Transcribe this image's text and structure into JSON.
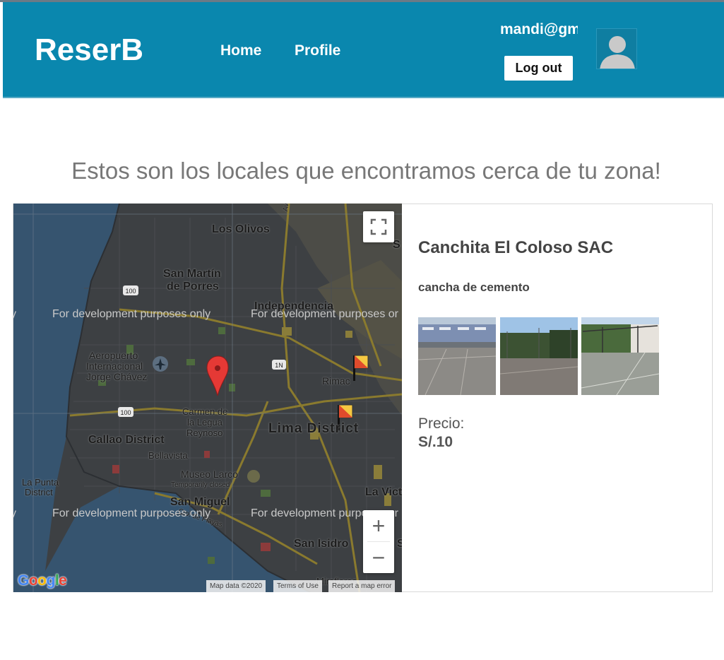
{
  "navbar": {
    "brand": "ReserB",
    "links": [
      {
        "label": "Home"
      },
      {
        "label": "Profile"
      }
    ],
    "user_email": "mandi@gm",
    "logout_label": "Log out",
    "bg_color": "#0a87ae"
  },
  "page": {
    "headline": "Estos son los locales que encontramos cerca de tu zona!"
  },
  "map": {
    "labels": {
      "los_olivos": "Los Olivos",
      "san_martin_1": "San Martín",
      "san_martin_2": "de Porres",
      "independencia": "Independencia",
      "aeropuerto_1": "Aeropuerto",
      "aeropuerto_2": "Internacional",
      "aeropuerto_3": "Jorge Chávez",
      "rimac": "Rimac",
      "carmen_1": "Carmen de",
      "carmen_2": "la Legua",
      "carmen_3": "Reynoso",
      "lima_district": "Lima District",
      "callao_district": "Callao District",
      "bellavista": "Bellavista",
      "museo_larco": "Museo Larco",
      "temporarily_closed": "Temporarily closed",
      "la_punta_1": "La Punta",
      "la_punta_2": "District",
      "san_miguel": "San Miguel",
      "la_victoria": "La Victoria",
      "san_isidro": "San Isidro",
      "miraflores": "Miraflores",
      "tupac_amaru": "Av. Tupac Amaru",
      "costa_verde": "Cto. de Playas",
      "road_100_a": "100",
      "road_100_b": "100",
      "road_1n": "1N",
      "partial_s": "S",
      "partial_y": "y"
    },
    "watermark": "For development purposes only",
    "watermark_cut": "For development purposes or",
    "zoom_in": "+",
    "zoom_out": "−",
    "google_logo": "Google",
    "attribution": {
      "map_data": "Map data ©2020",
      "terms": "Terms of Use",
      "report": "Report a map error"
    }
  },
  "venue": {
    "name": "Canchita El Coloso SAC",
    "type": "cancha de cemento",
    "price_label": "Precio:",
    "price_value": "S/.10",
    "photos": [
      "court-photo-1",
      "court-photo-2",
      "court-photo-3"
    ]
  }
}
